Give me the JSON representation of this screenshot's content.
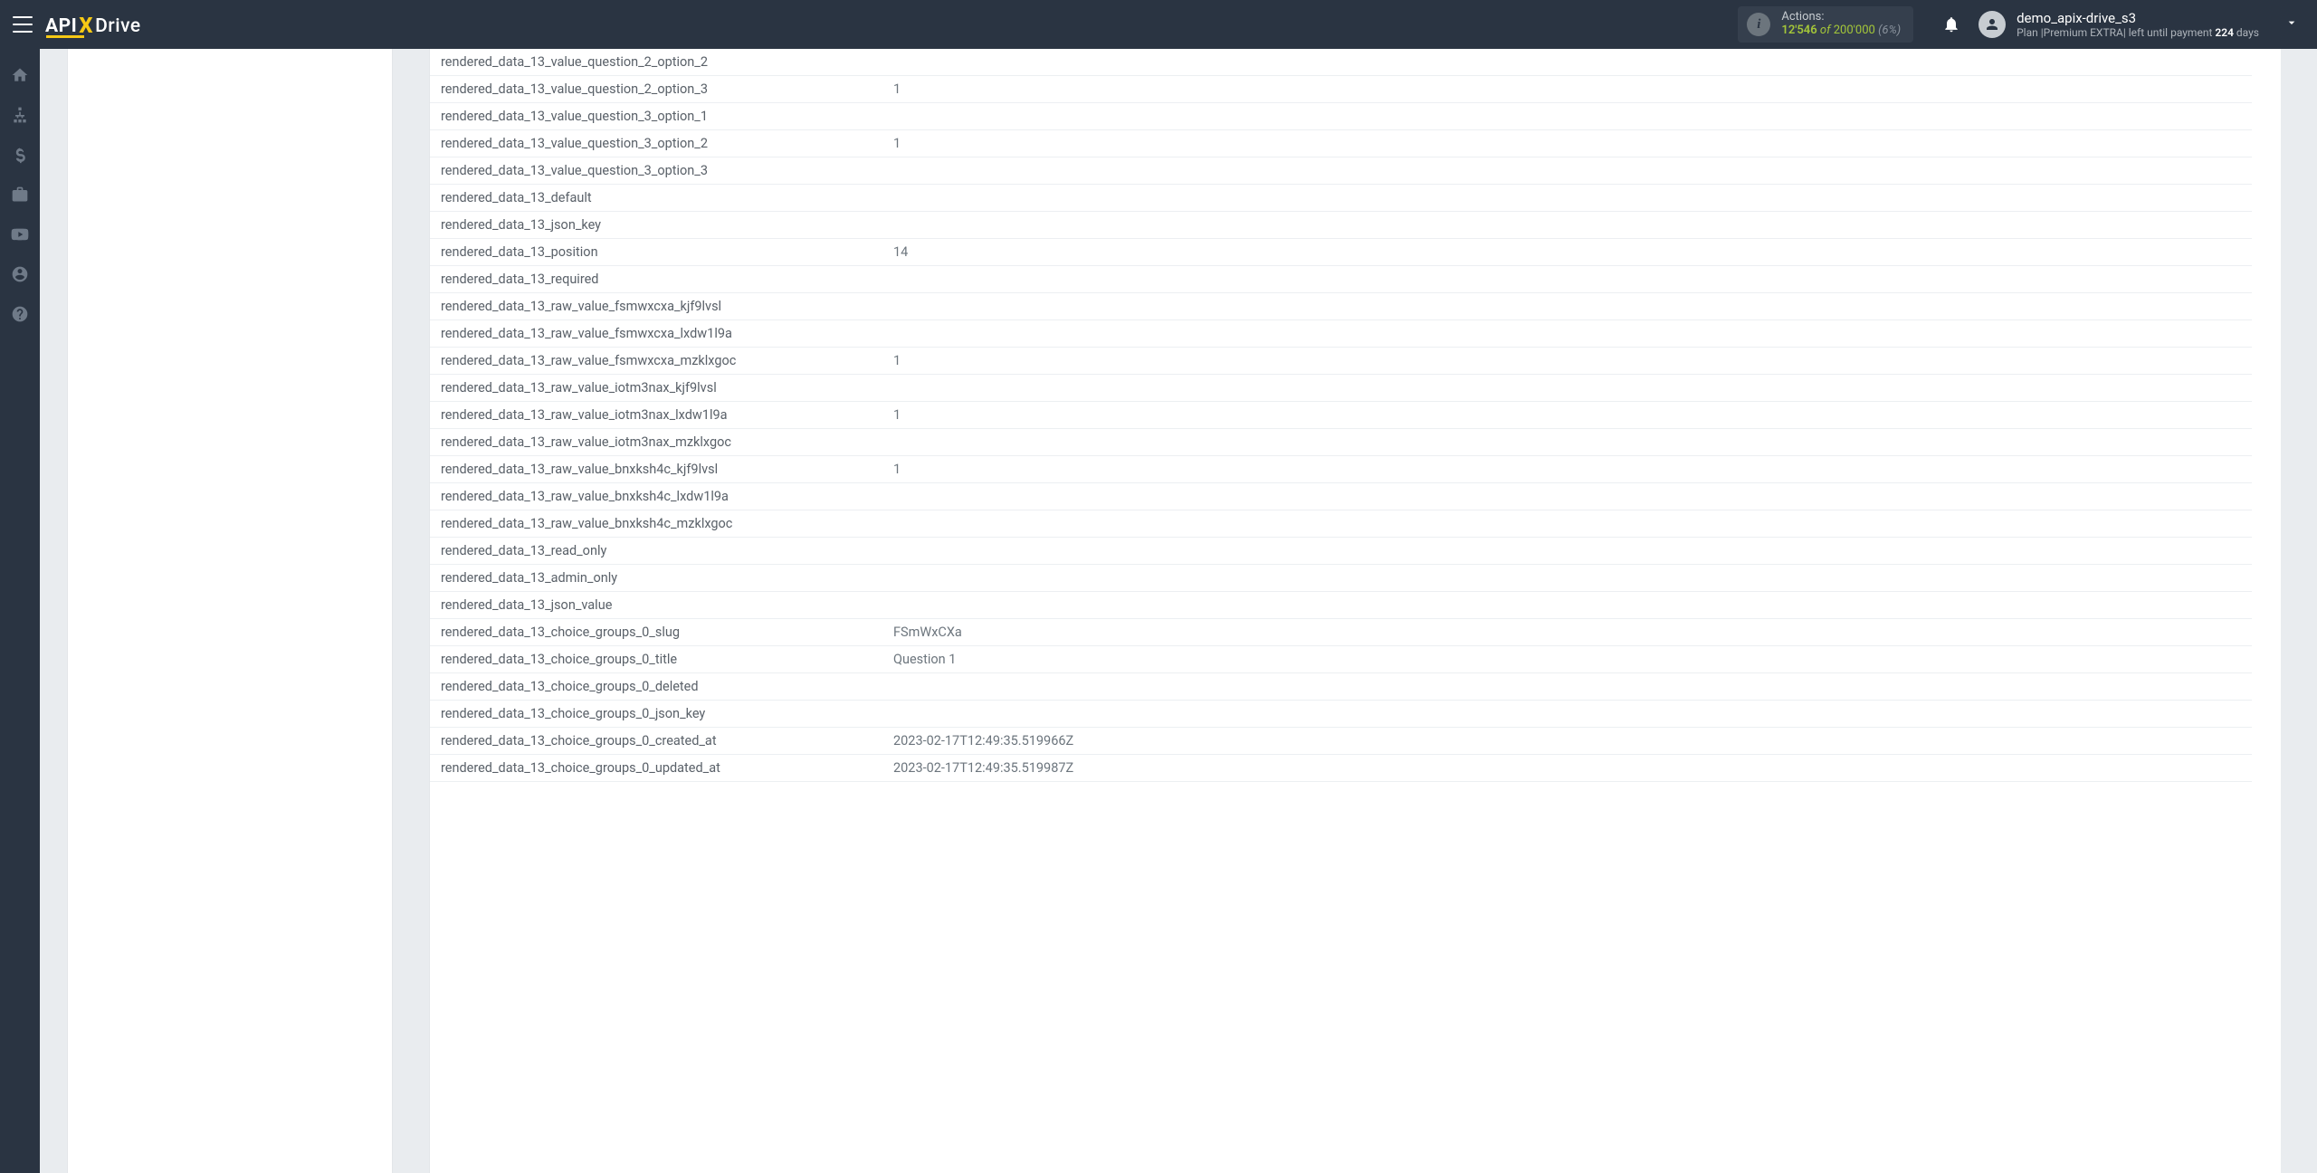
{
  "navbar": {
    "logo_api": "API",
    "logo_x": "X",
    "logo_drive": "Drive",
    "actions": {
      "label": "Actions:",
      "used": "12'546",
      "of": "of",
      "total": "200'000",
      "pct": "(6%)"
    },
    "user": {
      "name": "demo_apix-drive_s3",
      "plan_prefix": "Plan |",
      "plan_name": "Premium EXTRA",
      "plan_sep": "|",
      "plan_left": " left until payment ",
      "days_num": "224",
      "days_word": " days"
    }
  },
  "rows": [
    {
      "k": "rendered_data_13_value_question_2_option_2",
      "v": ""
    },
    {
      "k": "rendered_data_13_value_question_2_option_3",
      "v": "1"
    },
    {
      "k": "rendered_data_13_value_question_3_option_1",
      "v": ""
    },
    {
      "k": "rendered_data_13_value_question_3_option_2",
      "v": "1"
    },
    {
      "k": "rendered_data_13_value_question_3_option_3",
      "v": ""
    },
    {
      "k": "rendered_data_13_default",
      "v": ""
    },
    {
      "k": "rendered_data_13_json_key",
      "v": ""
    },
    {
      "k": "rendered_data_13_position",
      "v": "14"
    },
    {
      "k": "rendered_data_13_required",
      "v": ""
    },
    {
      "k": "rendered_data_13_raw_value_fsmwxcxa_kjf9lvsl",
      "v": ""
    },
    {
      "k": "rendered_data_13_raw_value_fsmwxcxa_lxdw1l9a",
      "v": ""
    },
    {
      "k": "rendered_data_13_raw_value_fsmwxcxa_mzklxgoc",
      "v": "1"
    },
    {
      "k": "rendered_data_13_raw_value_iotm3nax_kjf9lvsl",
      "v": ""
    },
    {
      "k": "rendered_data_13_raw_value_iotm3nax_lxdw1l9a",
      "v": "1"
    },
    {
      "k": "rendered_data_13_raw_value_iotm3nax_mzklxgoc",
      "v": ""
    },
    {
      "k": "rendered_data_13_raw_value_bnxksh4c_kjf9lvsl",
      "v": "1"
    },
    {
      "k": "rendered_data_13_raw_value_bnxksh4c_lxdw1l9a",
      "v": ""
    },
    {
      "k": "rendered_data_13_raw_value_bnxksh4c_mzklxgoc",
      "v": ""
    },
    {
      "k": "rendered_data_13_read_only",
      "v": ""
    },
    {
      "k": "rendered_data_13_admin_only",
      "v": ""
    },
    {
      "k": "rendered_data_13_json_value",
      "v": ""
    },
    {
      "k": "rendered_data_13_choice_groups_0_slug",
      "v": "FSmWxCXa"
    },
    {
      "k": "rendered_data_13_choice_groups_0_title",
      "v": "Question 1"
    },
    {
      "k": "rendered_data_13_choice_groups_0_deleted",
      "v": ""
    },
    {
      "k": "rendered_data_13_choice_groups_0_json_key",
      "v": ""
    },
    {
      "k": "rendered_data_13_choice_groups_0_created_at",
      "v": "2023-02-17T12:49:35.519966Z"
    },
    {
      "k": "rendered_data_13_choice_groups_0_updated_at",
      "v": "2023-02-17T12:49:35.519987Z"
    }
  ]
}
